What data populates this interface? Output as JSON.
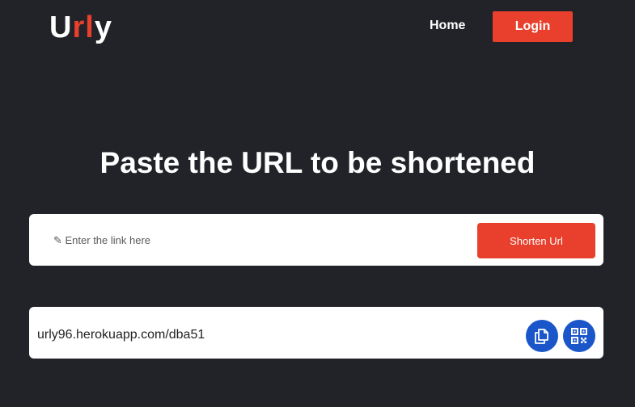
{
  "header": {
    "logo": {
      "part1": "U",
      "part2": "rl",
      "part3": "y"
    },
    "nav_home": "Home",
    "login": "Login"
  },
  "hero": {
    "title": "Paste the URL to be shortened"
  },
  "form": {
    "placeholder": "✎ Enter the link here",
    "value": "",
    "shorten_button": "Shorten Url"
  },
  "result": {
    "short_url": "urly96.herokuapp.com/dba51",
    "copy_icon": "copy-icon",
    "qr_icon": "qr-code-icon"
  },
  "colors": {
    "background": "#212328",
    "accent": "#e8402c",
    "icon_button": "#1a56c9"
  }
}
